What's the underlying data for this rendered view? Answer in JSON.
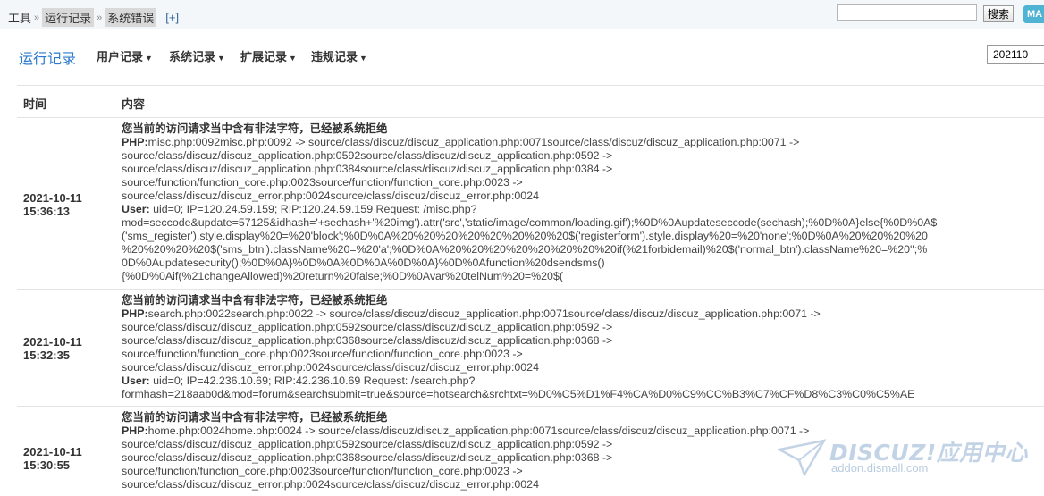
{
  "breadcrumb": {
    "items": [
      "工具",
      "运行记录",
      "系统错误"
    ],
    "add_label": "[+]"
  },
  "search": {
    "placeholder": "",
    "button_label": "搜索"
  },
  "badge_label": "MA",
  "nav": {
    "title": "运行记录",
    "items": [
      {
        "label": "用户记录"
      },
      {
        "label": "系统记录"
      },
      {
        "label": "扩展记录"
      },
      {
        "label": "违规记录"
      }
    ]
  },
  "year_select": {
    "value": "202110"
  },
  "table": {
    "headers": {
      "time": "时间",
      "content": "内容"
    },
    "rows": [
      {
        "date": "2021-10-11",
        "time": "15:36:13",
        "message": "您当前的访问请求当中含有非法字符，已经被系统拒绝",
        "php_label": "PHP:",
        "php_lines": [
          "misc.php:0092misc.php:0092 -> source/class/discuz/discuz_application.php:0071source/class/discuz/discuz_application.php:0071 ->",
          "source/class/discuz/discuz_application.php:0592source/class/discuz/discuz_application.php:0592 ->",
          "source/class/discuz/discuz_application.php:0384source/class/discuz/discuz_application.php:0384 ->",
          "source/function/function_core.php:0023source/function/function_core.php:0023 ->",
          "source/class/discuz/discuz_error.php:0024source/class/discuz/discuz_error.php:0024"
        ],
        "user_label": "User:",
        "user_lines": [
          " uid=0; IP=120.24.59.159; RIP:120.24.59.159 Request: /misc.php?",
          "mod=seccode&update=57125&idhash='+sechash+'%20img').attr('src','static/image/common/loading.gif');%0D%0Aupdateseccode(sechash);%0D%0A}else{%0D%0A$",
          "('sms_register').style.display%20=%20'block';%0D%0A%20%20%20%20%20%20%20%20$('registerform').style.display%20=%20'none';%0D%0A%20%20%20%20",
          "%20%20%20%20$('sms_btn').className%20=%20'a';%0D%0A%20%20%20%20%20%20%20%20if(%21forbidemail)%20$('normal_btn').className%20=%20'';%",
          "0D%0Aupdatesecurity();%0D%0A}%0D%0A%0D%0A%0D%0A}%0D%0Afunction%20dsendsms()",
          "{%0D%0Aif(%21changeAllowed)%20return%20false;%0D%0Avar%20telNum%20=%20$("
        ]
      },
      {
        "date": "2021-10-11",
        "time": "15:32:35",
        "message": "您当前的访问请求当中含有非法字符，已经被系统拒绝",
        "php_label": "PHP:",
        "php_lines": [
          "search.php:0022search.php:0022 -> source/class/discuz/discuz_application.php:0071source/class/discuz/discuz_application.php:0071 ->",
          "source/class/discuz/discuz_application.php:0592source/class/discuz/discuz_application.php:0592 ->",
          "source/class/discuz/discuz_application.php:0368source/class/discuz/discuz_application.php:0368 ->",
          "source/function/function_core.php:0023source/function/function_core.php:0023 ->",
          "source/class/discuz/discuz_error.php:0024source/class/discuz/discuz_error.php:0024"
        ],
        "user_label": "User:",
        "user_lines": [
          " uid=0; IP=42.236.10.69; RIP:42.236.10.69 Request: /search.php?",
          "formhash=218aab0d&mod=forum&searchsubmit=true&source=hotsearch&srchtxt=%D0%C5%D1%F4%CA%D0%C9%CC%B3%C7%CF%D8%C3%C0%C5%AE"
        ]
      },
      {
        "date": "2021-10-11",
        "time": "15:30:55",
        "message": "您当前的访问请求当中含有非法字符，已经被系统拒绝",
        "php_label": "PHP:",
        "php_lines": [
          "home.php:0024home.php:0024 -> source/class/discuz/discuz_application.php:0071source/class/discuz/discuz_application.php:0071 ->",
          "source/class/discuz/discuz_application.php:0592source/class/discuz/discuz_application.php:0592 ->",
          "source/class/discuz/discuz_application.php:0368source/class/discuz/discuz_application.php:0368 ->",
          "source/function/function_core.php:0023source/function/function_core.php:0023 ->",
          "source/class/discuz/discuz_error.php:0024source/class/discuz/discuz_error.php:0024"
        ],
        "user_label": "",
        "user_lines": []
      }
    ]
  },
  "watermark": {
    "brand": "DISCUZ!应用中心",
    "url": "addon.dismall.com"
  }
}
